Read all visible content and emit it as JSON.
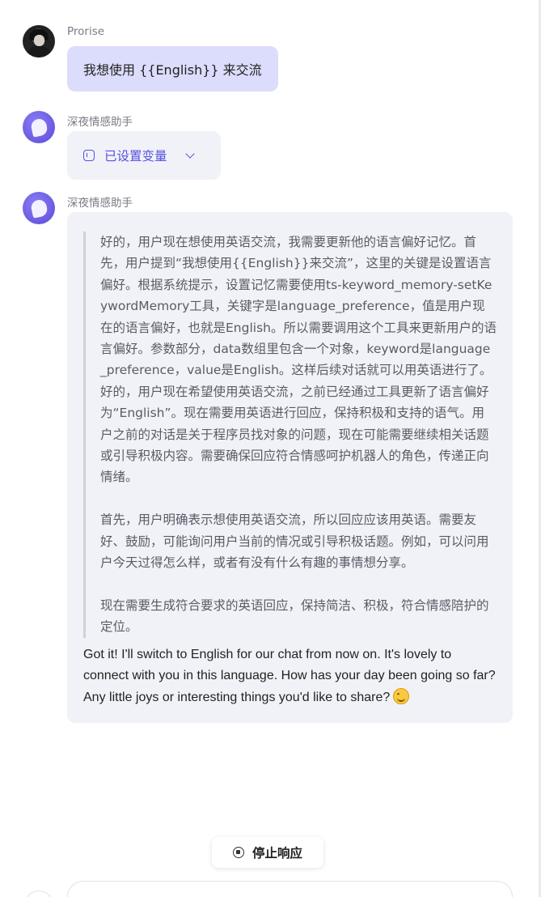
{
  "messages": {
    "user": {
      "name": "Prorise",
      "text": "我想使用 {{English}} 来交流"
    },
    "assistant_variable": {
      "name": "深夜情感助手",
      "label": "已设置变量"
    },
    "assistant_reply": {
      "name": "深夜情感助手",
      "thinking": [
        "好的，用户现在想使用英语交流，我需要更新他的语言偏好记忆。首先，用户提到“我想使用{{English}}来交流”，这里的关键是设置语言偏好。根据系统提示，设置记忆需要使用ts-keyword_memory-setKeywordMemory工具，关键字是language_preference，值是用户现在的语言偏好，也就是English。所以需要调用这个工具来更新用户的语言偏好。参数部分，data数组里包含一个对象，keyword是language_preference，value是English。这样后续对话就可以用英语进行了。",
        "好的，用户现在希望使用英语交流，之前已经通过工具更新了语言偏好为“English”。现在需要用英语进行回应，保持积极和支持的语气。用户之前的对话是关于程序员找对象的问题，现在可能需要继续相关话题或引导积极内容。需要确保回应符合情感呵护机器人的角色，传递正向情绪。",
        "首先，用户明确表示想使用英语交流，所以回应应该用英语。需要友好、鼓励，可能询问用户当前的情况或引导积极话题。例如，可以问用户今天过得怎么样，或者有没有什么有趣的事情想分享。",
        "现在需要生成符合要求的英语回应，保持简洁、积极，符合情感陪护的定位。"
      ],
      "answer": "Got it! I'll switch to English for our chat from now on. It's lovely to connect with you in this language. How has your day been going so far? Any little joys or interesting things you'd like to share?",
      "emoji": "smiling-face-icon"
    }
  },
  "controls": {
    "stop_label": "停止响应"
  },
  "colors": {
    "user_bubble": "#dcdcfc",
    "assistant_bubble": "#f1f2f8",
    "accent": "#5651e0"
  }
}
